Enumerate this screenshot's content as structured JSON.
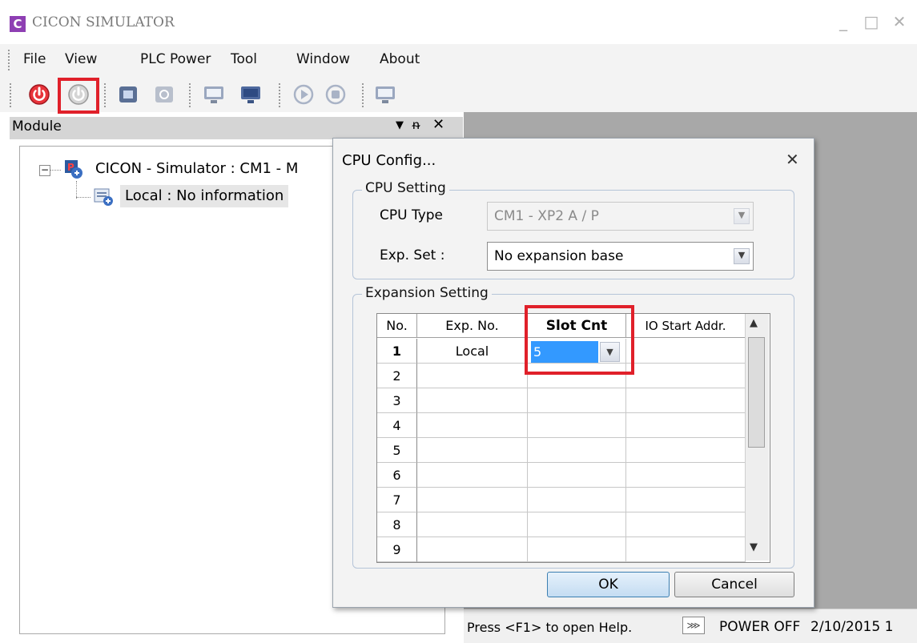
{
  "window": {
    "title": "CICON SIMULATOR",
    "icon": "C"
  },
  "menu": [
    "File",
    "View",
    "PLC Power",
    "Tool",
    "Window",
    "About"
  ],
  "module_panel": {
    "title": "Module",
    "tree_root": "CICON - Simulator : CM1 - M",
    "tree_child": "Local : No information"
  },
  "dialog": {
    "title": "CPU Config...",
    "cpu_group": "CPU Setting",
    "cpu_type_label": "CPU Type",
    "cpu_type_value": "CM1 - XP2 A / P",
    "exp_set_label": "Exp. Set :",
    "exp_set_value": "No expansion base",
    "exp_group": "Expansion Setting",
    "columns": [
      "No.",
      "Exp. No.",
      "Slot Cnt",
      "IO Start Addr."
    ],
    "rows": [
      {
        "no": "1",
        "exp": "Local",
        "slot": "5"
      },
      {
        "no": "2",
        "exp": "",
        "slot": ""
      },
      {
        "no": "3",
        "exp": "",
        "slot": ""
      },
      {
        "no": "4",
        "exp": "",
        "slot": ""
      },
      {
        "no": "5",
        "exp": "",
        "slot": ""
      },
      {
        "no": "6",
        "exp": "",
        "slot": ""
      },
      {
        "no": "7",
        "exp": "",
        "slot": ""
      },
      {
        "no": "8",
        "exp": "",
        "slot": ""
      },
      {
        "no": "9",
        "exp": "",
        "slot": ""
      }
    ],
    "ok": "OK",
    "cancel": "Cancel"
  },
  "status": {
    "help": "Press <F1> to open Help.",
    "power": "POWER OFF",
    "date": "2/10/2015 1"
  },
  "colors": {
    "accent": "#e0202a",
    "selection": "#3399ff"
  }
}
